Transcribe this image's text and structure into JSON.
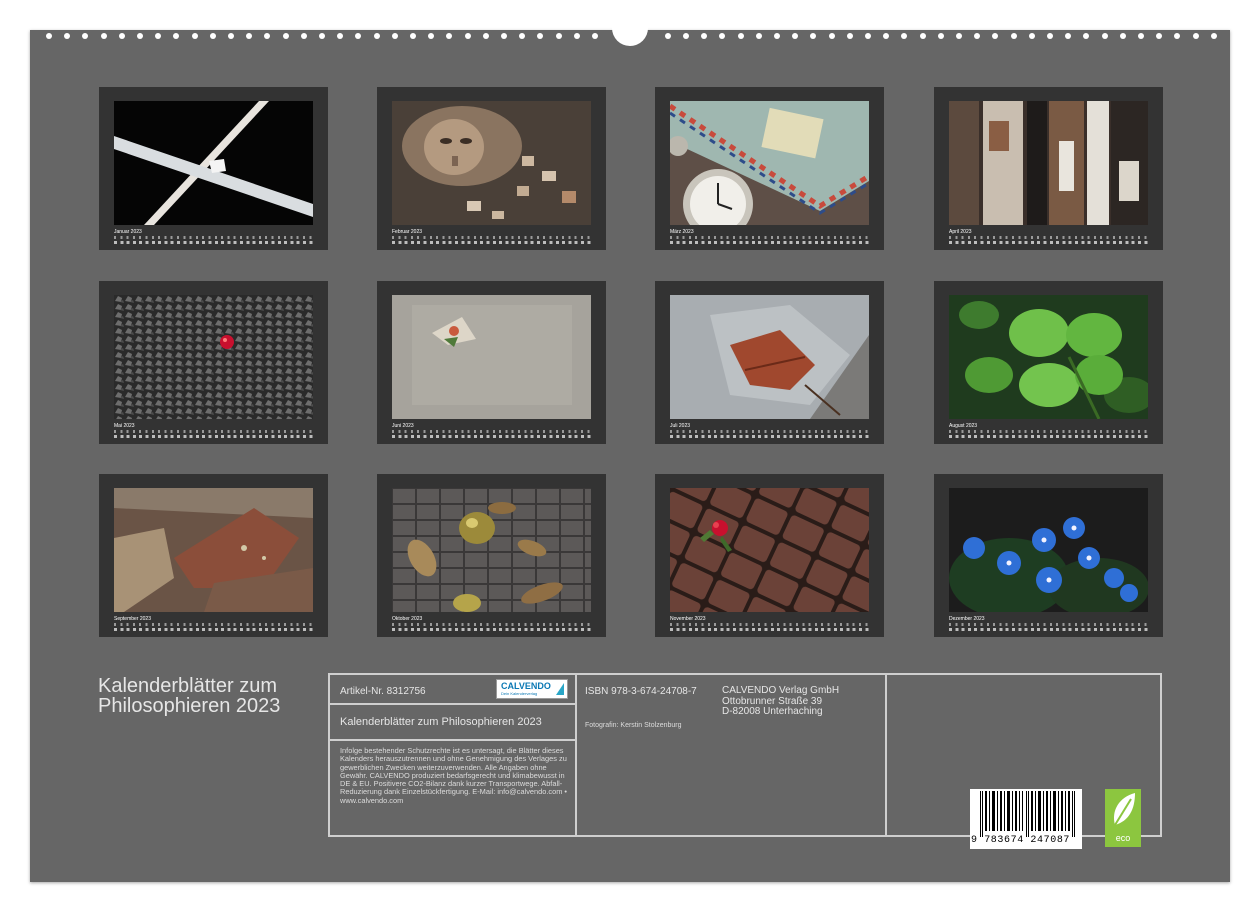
{
  "calendar_title": "Kalenderblätter zum Philosophieren 2023",
  "months": [
    {
      "label": "Januar 2023",
      "photo_icon": "white-cross-beams-photo",
      "caption": ""
    },
    {
      "label": "Februar 2023",
      "photo_icon": "jigsaw-face-photo",
      "caption": ""
    },
    {
      "label": "März 2023",
      "photo_icon": "airmail-envelope-pocket-watch-photo",
      "caption": ""
    },
    {
      "label": "April 2023",
      "photo_icon": "peeling-wood-photo",
      "caption": ""
    },
    {
      "label": "Mai 2023",
      "photo_icon": "gravel-red-bead-photo",
      "caption": ""
    },
    {
      "label": "Juni 2023",
      "photo_icon": "plaster-wall-photo",
      "caption": ""
    },
    {
      "label": "Juli 2023",
      "photo_icon": "leaf-under-plastic-photo",
      "caption": ""
    },
    {
      "label": "August 2023",
      "photo_icon": "four-leaf-clover-photo",
      "caption": ""
    },
    {
      "label": "September 2023",
      "photo_icon": "rocks-photo",
      "caption": ""
    },
    {
      "label": "Oktober 2023",
      "photo_icon": "cobblestones-leaves-photo",
      "caption": ""
    },
    {
      "label": "November 2023",
      "photo_icon": "red-rose-cobbles-photo",
      "caption": ""
    },
    {
      "label": "Dezember 2023",
      "photo_icon": "blue-forget-me-not-photo",
      "caption": ""
    }
  ],
  "info": {
    "article_no": "Artikel-Nr. 8312756",
    "title_line": "Kalenderblätter zum Philosophieren 2023",
    "logo_text": "CALVENDO",
    "logo_sub": "Dein Kalenderverlag",
    "legal_text": "Infolge bestehender Schutzrechte ist es untersagt, die Blätter dieses Kalenders herauszutrennen und ohne Genehmigung des Verlages zu gewerblichen Zwecken weiterzuverwenden. Alle Angaben ohne Gewähr. CALVENDO produziert bedarfsgerecht und klimabewusst in DE & EU. Positivere CO2-Bilanz dank kurzer Transportwege. Abfall-Reduzierung dank Einzelstückfertigung. E-Mail: info@calvendo.com • www.calvendo.com",
    "isbn": "ISBN 978-3-674-24708-7",
    "publisher_name": "CALVENDO Verlag GmbH",
    "publisher_street": "Ottobrunner Straße 39",
    "publisher_city": "D-82008 Unterhaching",
    "photographer": "Fotografin: Kerstin Stolzenburg",
    "barcode_number": "9 783674 247087",
    "eco_label": "eco"
  },
  "colors": {
    "sheet": "#666666",
    "card": "#333333",
    "caption": "#b02020",
    "eco": "#8cc63f",
    "logo": "#0a78b4"
  }
}
